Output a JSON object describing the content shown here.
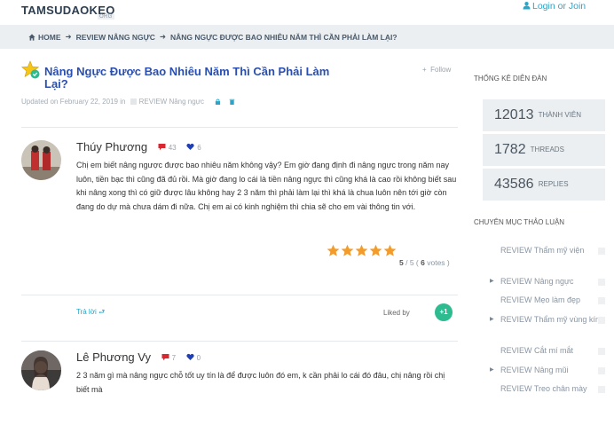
{
  "header": {
    "logo_text": "TAMSUDAOKEO",
    "logo_suffix": "ORG",
    "login_label": "Login or Join"
  },
  "breadcrumb": {
    "home": "HOME",
    "section": "REVIEW NÂNG NGỰC",
    "current": "NÂNG NGỰC ĐƯỢC BAO NHIÊU NĂM THÌ CẦN PHẢI LÀM LẠI?"
  },
  "thread": {
    "title": "Nâng Ngực Được Bao Nhiêu Năm Thì Cần Phải Làm Lại?",
    "follow_label": "Follow",
    "updated": "Updated on February 22, 2019 in",
    "category": "REVIEW Nâng ngực"
  },
  "posts": [
    {
      "author": "Thúy Phương",
      "comments": "43",
      "likes": "6",
      "body": "Chị em biết nâng ngược được bao nhiêu năm không vậy? Em giờ đang định đi nâng ngực trong năm nay luôn, tiền bạc thì cũng đã đủ rồi. Mà giờ đang lo cái là tiền nâng ngực thì cũng khá là cao rồi không biết sau khi nâng xong thì có giữ được lâu không hay 2 3 năm thì phải làm lại thì khá là chua luôn nên tới giờ còn đang do dự mà chưa dám đi nữa. Chị em ai có kinh nghiệm thì chia sẽ cho em vài thông tin với.",
      "rating": "5",
      "rating_max": "5",
      "votes": "6",
      "votes_label": "votes",
      "reply_label": "Trả lời",
      "liked_by_label": "Liked by",
      "plus_label": "+1"
    },
    {
      "author": "Lê Phương Vy",
      "comments": "7",
      "likes": "0",
      "body": "2 3 năm gì mà nâng ngực chỗ tốt uy tín là để được luôn đó em, k cần phải lo cái đó đâu, chị nâng rồi chị biết mà"
    }
  ],
  "sidebar": {
    "stats_heading": "THỐNG KÊ DIỄN ĐÀN",
    "stats": [
      {
        "value": "12013",
        "label": "THÀNH VIÊN"
      },
      {
        "value": "1782",
        "label": "THREADS"
      },
      {
        "value": "43586",
        "label": "REPLIES"
      }
    ],
    "categories_heading": "CHUYÊN MỤC THẢO LUẬN",
    "categories": [
      {
        "label": "REVIEW Thẩm mỹ viện",
        "arrow": false
      },
      {
        "label": "REVIEW Nâng ngực",
        "arrow": true
      },
      {
        "label": "REVIEW Mẹo làm đẹp",
        "arrow": false
      },
      {
        "label": "REVIEW Thẩm mỹ vùng kín",
        "arrow": true
      },
      {
        "label": "REVIEW Cắt mí mắt",
        "arrow": false
      },
      {
        "label": "REVIEW Nâng mũi",
        "arrow": true
      },
      {
        "label": "REVIEW Treo chân mày",
        "arrow": false
      }
    ]
  },
  "colors": {
    "accent": "#2aa5c7",
    "title_blue": "#2a4fb0",
    "comment_red": "#d9262f",
    "heart_blue": "#1f3fb8",
    "star_orange": "#f39c2b",
    "plus_green": "#2dbb8f"
  }
}
